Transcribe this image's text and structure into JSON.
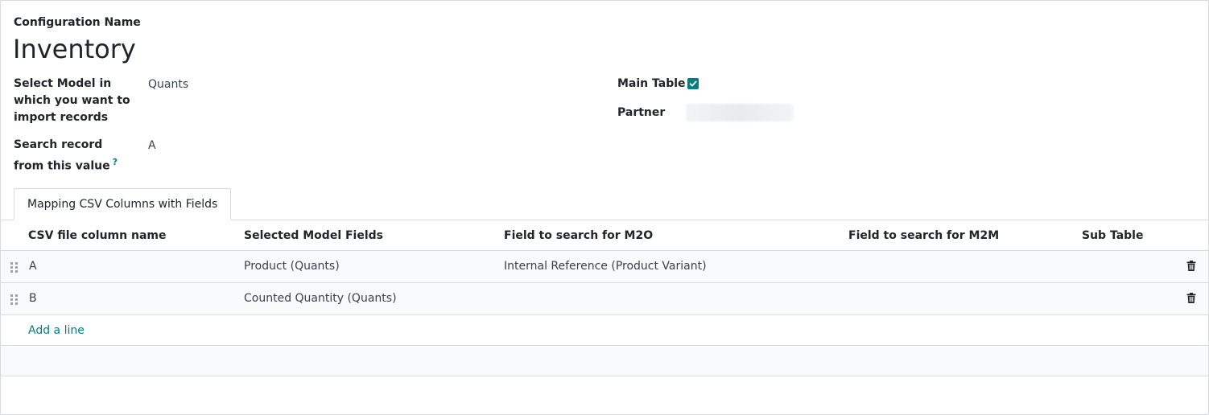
{
  "form": {
    "config_name_label": "Configuration Name",
    "config_name_value": "Inventory",
    "model_label": "Select Model in which you want to import records",
    "model_value": "Quants",
    "search_label": "Search record from this value",
    "search_help": "?",
    "search_value": "A",
    "main_table_label": "Main Table",
    "main_table_checked": true,
    "partner_label": "Partner"
  },
  "tabs": [
    {
      "label": "Mapping CSV Columns with Fields",
      "active": true
    }
  ],
  "table": {
    "headers": [
      "CSV file column name",
      "Selected Model Fields",
      "Field to search for M2O",
      "Field to search for M2M",
      "Sub Table"
    ],
    "rows": [
      {
        "csv": "A",
        "field": "Product (Quants)",
        "m2o": "Internal Reference (Product Variant)",
        "m2m": "",
        "sub": ""
      },
      {
        "csv": "B",
        "field": "Counted Quantity (Quants)",
        "m2o": "",
        "m2m": "",
        "sub": ""
      }
    ],
    "add_line": "Add a line"
  },
  "colors": {
    "accent": "#017e84",
    "border": "#d8dadd"
  },
  "icons": {
    "row_handle": "drag-handle-icon",
    "row_delete": "trash-icon",
    "checkbox": "check-icon"
  }
}
